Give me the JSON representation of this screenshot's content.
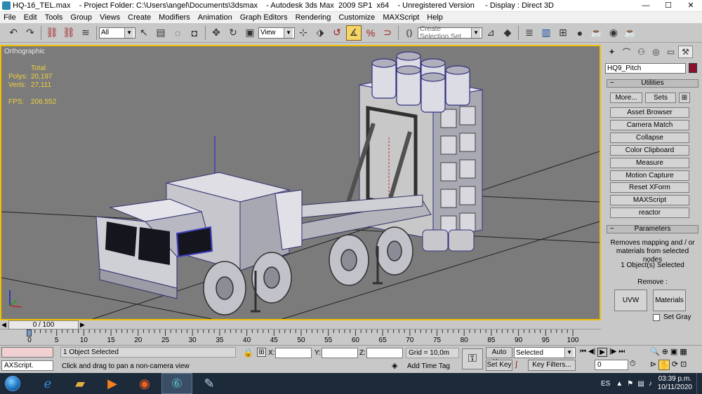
{
  "window": {
    "title": "HQ-16_TEL.max    - Project Folder: C:\\Users\\angel\\Documents\\3dsmax    - Autodesk 3ds Max  2009 SP1  x64    - Unregistered Version     - Display : Direct 3D",
    "minimize": "—",
    "maximize": "☐",
    "close": "✕"
  },
  "menu": [
    "File",
    "Edit",
    "Tools",
    "Group",
    "Views",
    "Create",
    "Modifiers",
    "Animation",
    "Graph Editors",
    "Rendering",
    "Customize",
    "MAXScript",
    "Help"
  ],
  "toolbar": {
    "selection_filter": "All",
    "ref_coord": "View",
    "named_selection_placeholder": "Create Selection Set"
  },
  "viewport": {
    "label": "Orthographic",
    "stats_header": "Total",
    "polys_label": "Polys:",
    "polys_value": "20,197",
    "verts_label": "Verts:",
    "verts_value": "27,111",
    "fps_label": "FPS:",
    "fps_value": "206.552"
  },
  "command_panel": {
    "object_name": "HQ9_Pitch",
    "object_color": "#8a1030",
    "utilities_title": "Utilities",
    "more_button": "More...",
    "sets_button": "Sets",
    "utilities": [
      "Asset Browser",
      "Camera Match",
      "Collapse",
      "Color Clipboard",
      "Measure",
      "Motion Capture",
      "Reset XForm",
      "MAXScript",
      "reactor"
    ],
    "parameters_title": "Parameters",
    "description": "Removes mapping and / or materials from selected nodes",
    "selection_count": "1 Object(s) Selected",
    "remove_label": "Remove :",
    "uvw_button": "UVW",
    "materials_button": "Materials",
    "set_gray_label": "Set Gray"
  },
  "timeline": {
    "slider_text": "0 / 100",
    "ticks": [
      "0",
      "5",
      "10",
      "15",
      "20",
      "25",
      "30",
      "35",
      "40",
      "45",
      "50",
      "55",
      "60",
      "65",
      "70",
      "75",
      "80",
      "85",
      "90",
      "95",
      "100"
    ]
  },
  "status": {
    "maxscript_label": "AXScript.",
    "selected_text": "1 Object Selected",
    "prompt_text": "Click and drag to pan a non-camera view",
    "x_label": "X:",
    "y_label": "Y:",
    "z_label": "Z:",
    "grid_text": "Grid = 10,0m",
    "add_time_tag": "Add Time Tag",
    "auto_key": "Auto Key",
    "set_key": "Set Key",
    "key_mode": "Selected",
    "key_filters": "Key Filters...",
    "frame_value": "0"
  },
  "taskbar": {
    "language": "ES",
    "time": "03:39 p.m.",
    "date": "10/11/2020"
  },
  "colors": {
    "viewport_bg": "#7b7b7b",
    "viewport_border": "#f0c000",
    "stats_text": "#f0d040",
    "taskbar_bg": "#1c2a3a"
  }
}
